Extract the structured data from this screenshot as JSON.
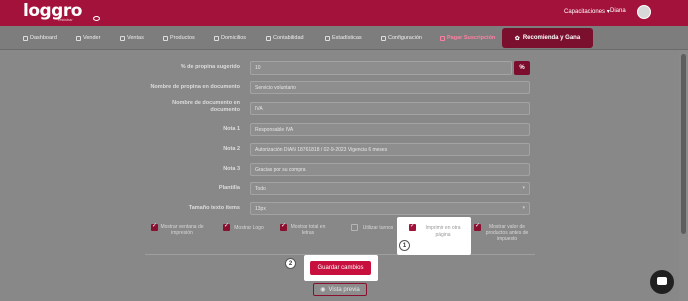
{
  "header": {
    "logo": "loggro",
    "logo_sub": "restobar",
    "capacitaciones": "Capacitaciones",
    "user_name": "Diana"
  },
  "nav": {
    "items": [
      "Dashboard",
      "Vender",
      "Ventas",
      "Productos",
      "Domicilios",
      "Contabilidad",
      "Estadísticas",
      "Configuración",
      "Pagar Suscripción"
    ],
    "recommend": "Recomienda y Gana"
  },
  "form": {
    "tip_label": "% de propina sugerido",
    "tip_value": "10",
    "tip_unit": "%",
    "tip_name_label": "Nombre de propina en documento",
    "tip_name_value": "Servicio voluntario",
    "doc_name_label": "Nombre de documento en documento",
    "doc_name_value": "IVA",
    "nota1_label": "Nota 1",
    "nota1_value": "Responsable IVA",
    "nota2_label": "Nota 2",
    "nota2_value": "Autorización DIAN 18761818 / 02-9-2023 Vigencia 6 meses",
    "nota3_label": "Nota 3",
    "nota3_value": "Gracias por su compra",
    "plantilla_label": "Plantilla",
    "plantilla_value": "Todo",
    "tamano_label": "Tamaño texto ítems",
    "tamano_value": "13px"
  },
  "checkboxes": {
    "ventana": "Mostrar ventana de impresión",
    "logo": "Mostrar Logo",
    "letras": "Mostrar total en letras",
    "turnos": "Utilizar turnos",
    "otra_pagina": "Imprimir en otra página",
    "valor": "Mostrar valor de productos antes de impuesto"
  },
  "badges": {
    "one": "1",
    "two": "2"
  },
  "buttons": {
    "save": "Guardar cambios",
    "preview": "Vista previa"
  },
  "colors": {
    "brand": "#a3123b",
    "button": "#c8103e"
  }
}
